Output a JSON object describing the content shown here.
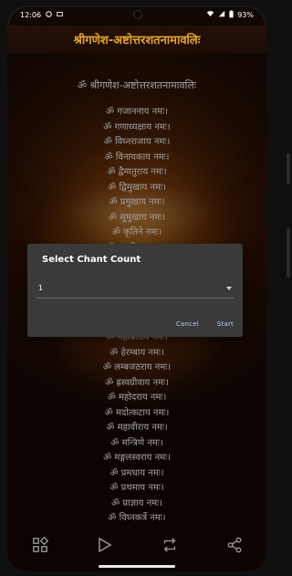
{
  "status": {
    "time": "12:06",
    "battery": "93%"
  },
  "app": {
    "title": "श्रीगणेश-अष्टोत्तरशतनामावलिः"
  },
  "content": {
    "heading": "ॐ श्रीगणेश-अष्टोत्तरशतनामावलिः",
    "names_top": [
      "ॐ गजाननाय नमः।",
      "ॐ गणाध्यक्षाय नमः।",
      "ॐ विघ्नराजाय नमः।",
      "ॐ विनायकाय नमः।",
      "ॐ द्वैमातुराय नमः।",
      "ॐ द्विमुखाय नमः।",
      "ॐ प्रमुखाय नमः।",
      "ॐ सुमुखाय नमः।",
      "ॐ कृतिने नमः।",
      "ॐ सुप्रदीपाय नमः।"
    ],
    "names_bottom": [
      "ॐ महाबलाय नमः।",
      "ॐ हेरम्बाय नमः।",
      "ॐ लम्बजठराय नमः।",
      "ॐ ह्रस्वग्रीवाय नमः।",
      "ॐ महोदराय नमः।",
      "ॐ मदोत्कटाय नमः।",
      "ॐ महावीराय नमः।",
      "ॐ मन्त्रिणे नमः।",
      "ॐ मङ्गलस्वराय नमः।",
      "ॐ प्रमधाय नमः।",
      "ॐ प्रथमाय नमः।",
      "ॐ प्राज्ञाय नमः।",
      "ॐ विघ्नकर्त्रे नमः।"
    ]
  },
  "dialog": {
    "title": "Select Chant Count",
    "selected_value": "1",
    "cancel_label": "Cancel",
    "start_label": "Start"
  },
  "bottom_bar": {
    "icons": [
      "apps-icon",
      "play-icon",
      "repeat-icon",
      "share-icon"
    ]
  },
  "colors": {
    "title": "#e6a526",
    "dialog_bg": "#3a3a3a",
    "dialog_button": "#b9c8ff"
  }
}
